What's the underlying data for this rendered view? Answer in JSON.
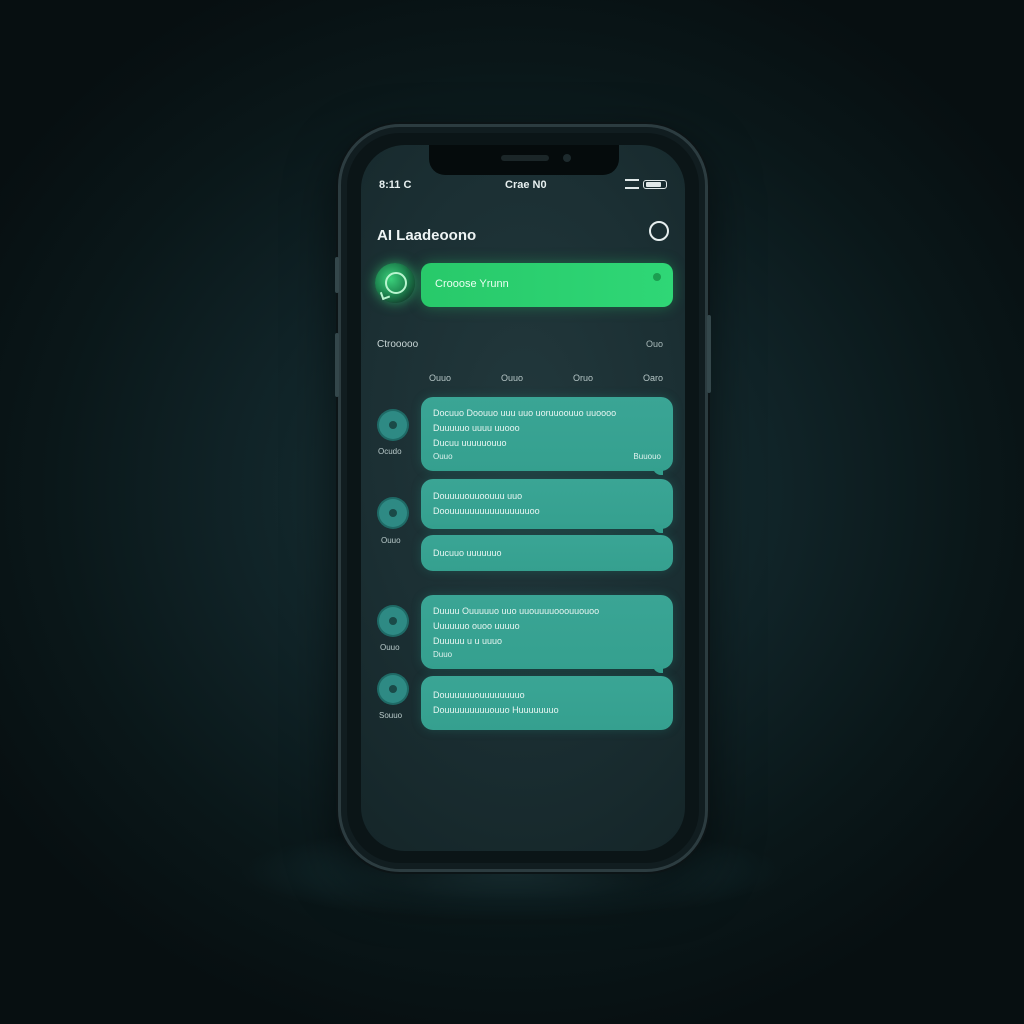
{
  "status_bar": {
    "left": "8:11 C",
    "center": "Crae N0"
  },
  "header": {
    "title": "AI Laadeoono"
  },
  "chat_cta": {
    "label": "Crooose Yrunn"
  },
  "section": {
    "label": "Ctrooooo",
    "action": "Ouo"
  },
  "filter_tabs": [
    "Ouuo",
    "Ouuo",
    "Oruo",
    "Oaro"
  ],
  "messages": [
    {
      "name": "Ocudo",
      "lines": [
        "Docuuo Doouuo uuu uuo uoruuoouuo uuoooo",
        "Duuuuuo uuuu uuooo",
        "Ducuu uuuuuouuo"
      ],
      "meta_left": "Ouuo",
      "meta_right": "Buuouo"
    },
    {
      "name": "Ouuo",
      "lines": [
        "Douuuuouuoouuu uuo",
        "Doouuuuuuuuuuuuuuuuoo"
      ],
      "meta_left": "",
      "meta_right": ""
    },
    {
      "name": "",
      "lines": [
        "Ducuuo uuuuuuo"
      ],
      "meta_left": "",
      "meta_right": ""
    },
    {
      "name": "Ouuo",
      "lines": [
        "Duuuu Ouuuuuo uuo uuouuuuooouuouoo",
        "Uuuuuuo ouoo uuuuo",
        "Duuuuu u u uuuo"
      ],
      "meta_left": "Duuo",
      "meta_right": ""
    },
    {
      "name": "Souuo",
      "lines": [
        "Douuuuuuouuuuuuuuo",
        "Douuuuuuuuuouuo Huuuuuuuo"
      ],
      "meta_left": "",
      "meta_right": ""
    }
  ],
  "colors": {
    "accent_green": "#2fd776",
    "bubble_teal": "#3aa595",
    "screen_bg": "#1b2f33"
  },
  "icons": {
    "profile": "profile-icon",
    "bot": "chatbot-icon",
    "battery": "battery-icon",
    "signal": "signal-icon"
  }
}
